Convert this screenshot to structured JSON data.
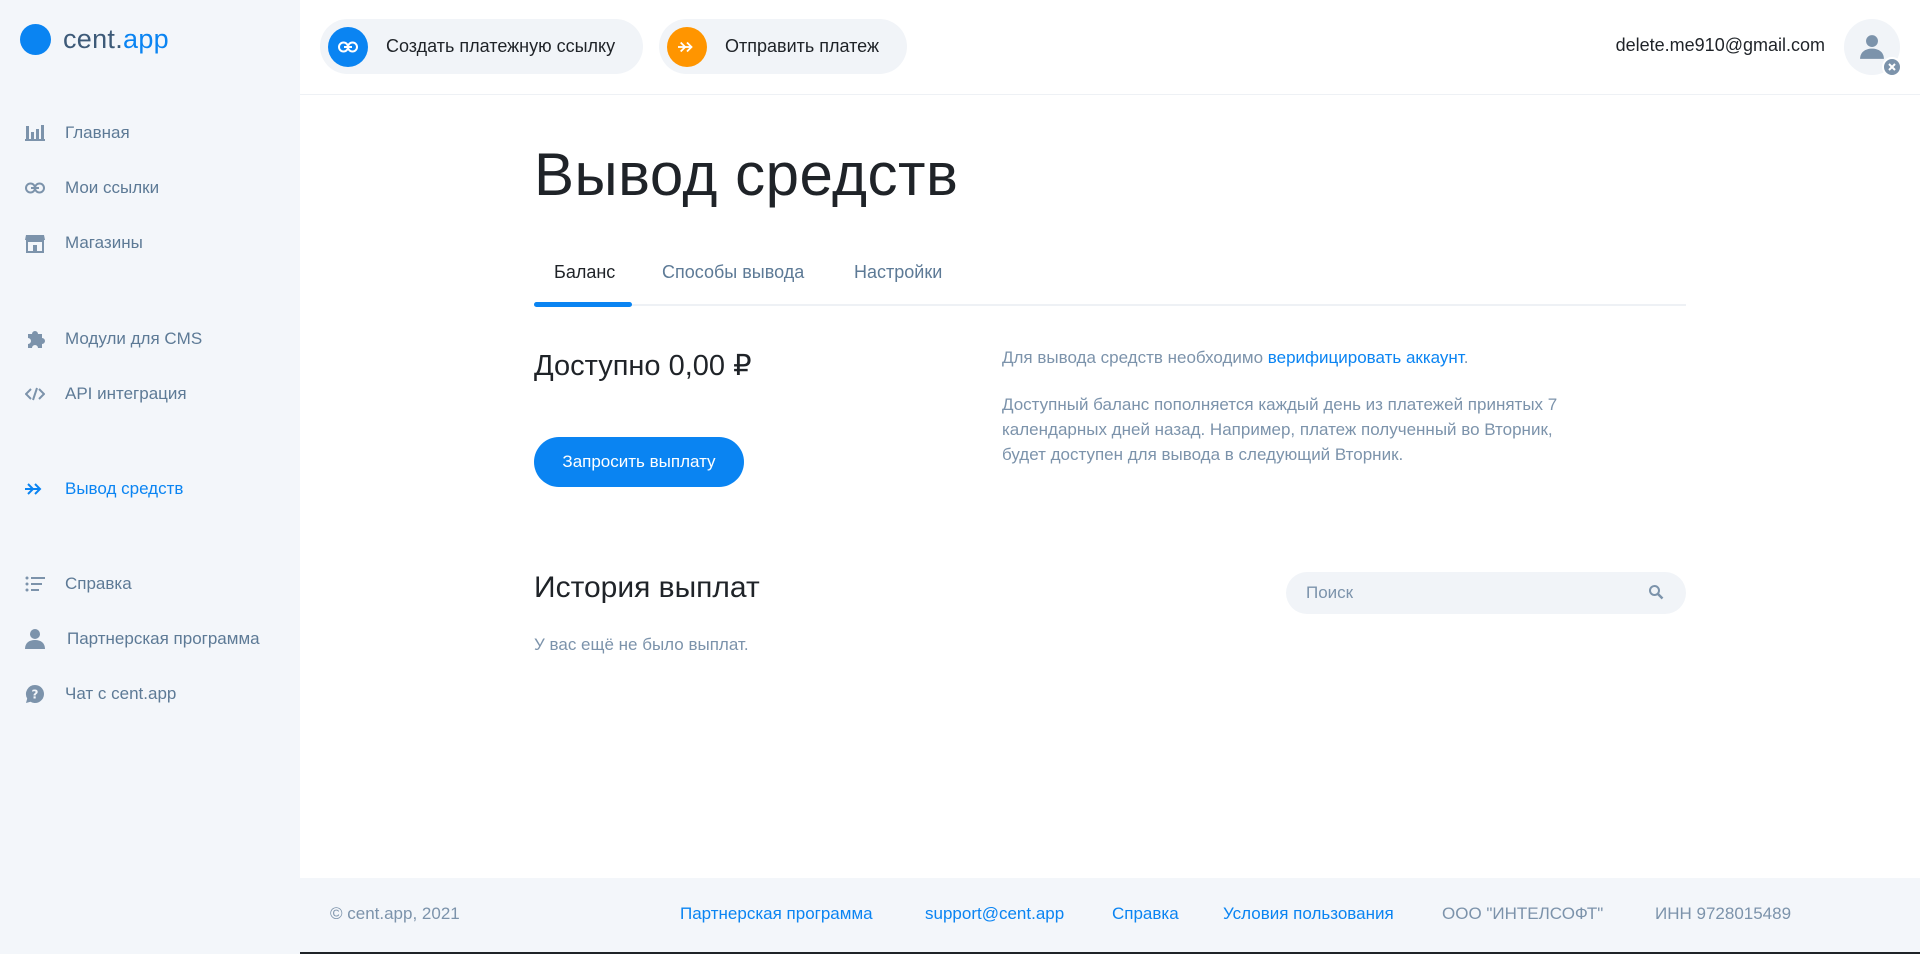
{
  "logo": {
    "part1": "cent.",
    "part2": "app"
  },
  "sidebar": {
    "items": [
      {
        "label": "Главная",
        "icon": "bar-chart-icon"
      },
      {
        "label": "Мои ссылки",
        "icon": "link-icon"
      },
      {
        "label": "Магазины",
        "icon": "store-icon"
      },
      {
        "label": "Модули для CMS",
        "icon": "puzzle-icon"
      },
      {
        "label": "API интеграция",
        "icon": "code-icon"
      },
      {
        "label": "Вывод средств",
        "icon": "double-arrow-icon",
        "active": true
      },
      {
        "label": "Справка",
        "icon": "list-icon"
      },
      {
        "label": "Партнерская программа",
        "icon": "user-icon"
      },
      {
        "label": "Чат с cent.app",
        "icon": "help-chat-icon"
      }
    ]
  },
  "topbar": {
    "create_link": "Создать платежную ссылку",
    "send_payment": "Отправить платеж",
    "email": "delete.me910@gmail.com"
  },
  "main": {
    "title": "Вывод средств",
    "tabs": [
      {
        "label": "Баланс",
        "active": true
      },
      {
        "label": "Способы вывода"
      },
      {
        "label": "Настройки"
      }
    ],
    "available": "Доступно 0,00 ₽",
    "request_button": "Запросить выплату",
    "verify_prefix": "Для вывода средств необходимо ",
    "verify_link": "верифицировать аккаунт",
    "verify_suffix": ".",
    "balance_info": "Доступный баланс пополняется каждый день из платежей принятых 7 календарных дней назад. Например, платеж полученный во Вторник, будет доступен для вывода в следующий Вторник.",
    "history_title": "История выплат",
    "search_placeholder": "Поиск",
    "no_payouts": "У вас ещё не было выплат."
  },
  "footer": {
    "copyright": "© cent.app, 2021",
    "partner": "Партнерская программа",
    "support": "support@cent.app",
    "help": "Справка",
    "terms": "Условия пользования",
    "company": "ООО \"ИНТЕЛСОФТ\"",
    "inn": "ИНН 9728015489"
  },
  "colors": {
    "accent": "#0a84f2",
    "orange": "#ff9500",
    "sidebar_bg": "#f3f6fa",
    "muted": "#7c93ab"
  }
}
